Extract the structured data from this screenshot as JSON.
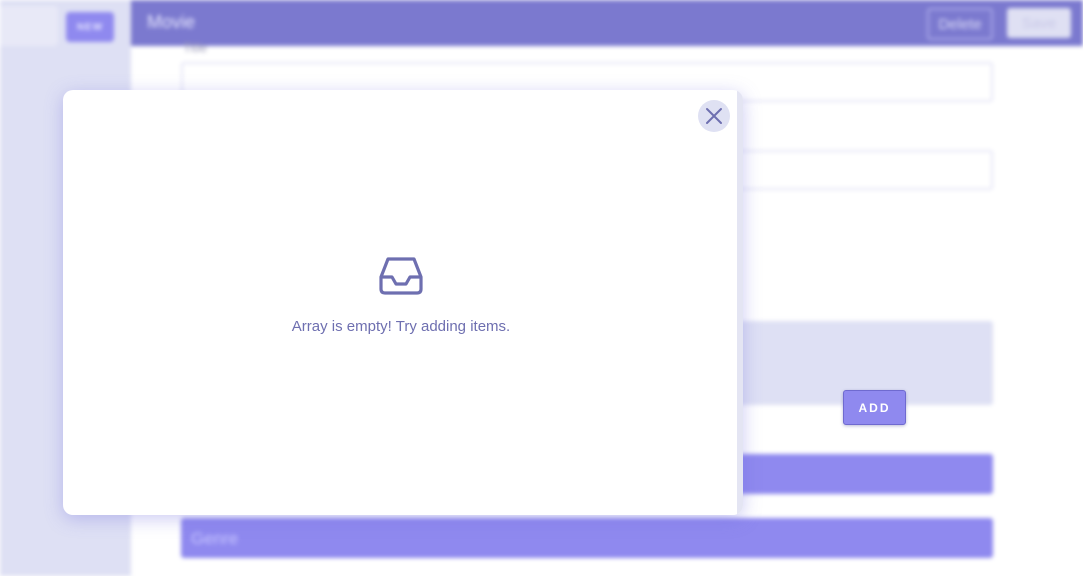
{
  "sidebar": {
    "new_label": "NEW"
  },
  "header": {
    "title": "Movie",
    "delete_label": "Delete",
    "save_label": "Save"
  },
  "form": {
    "title_label": "Title",
    "genre_label": "Genre",
    "add_label": "ADD"
  },
  "modal": {
    "empty_message": "Array is empty! Try adding items.",
    "empty_icon": "inbox-icon",
    "close_icon": "close-icon"
  },
  "colors": {
    "accent": "#8f89ef",
    "header": "#7b79cf",
    "sidebar": "#dee0f4",
    "icon": "#6e6fb0"
  }
}
